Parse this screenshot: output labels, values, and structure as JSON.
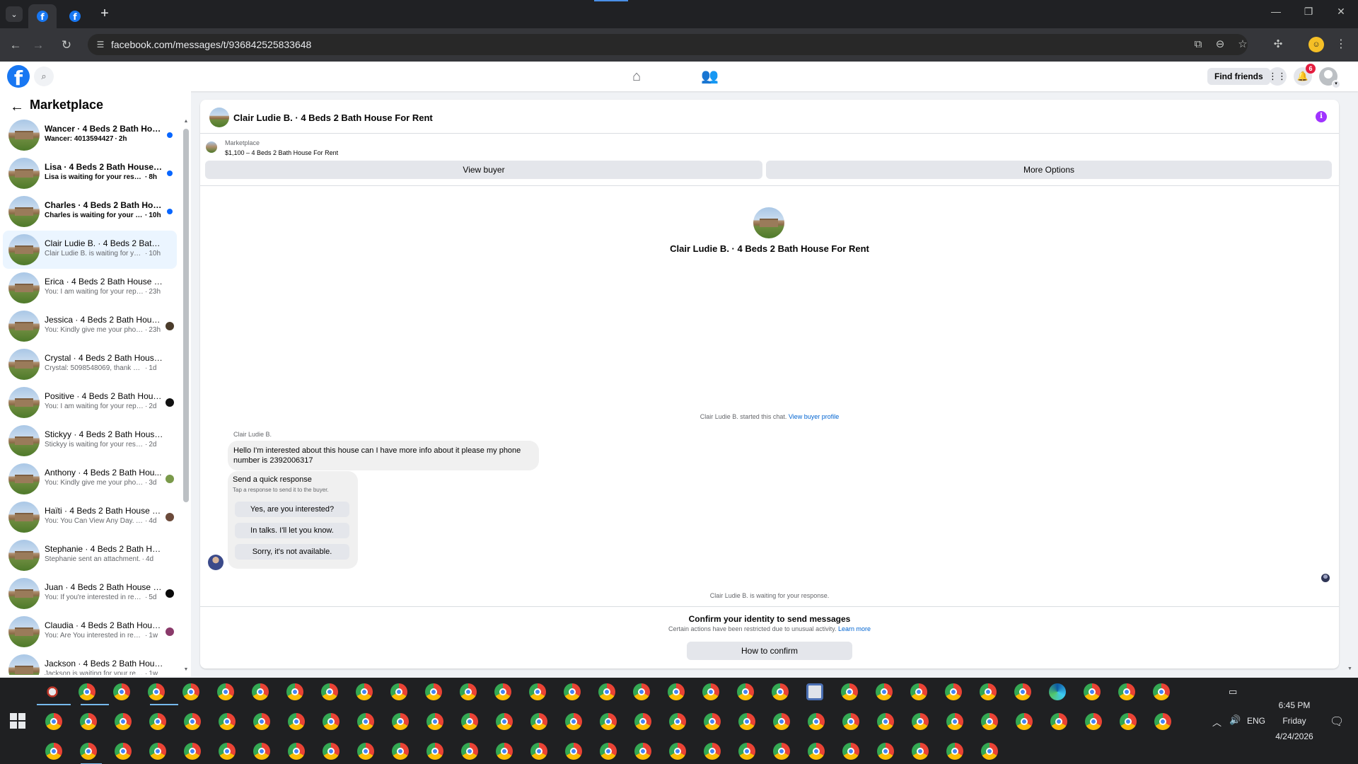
{
  "browser": {
    "url": "facebook.com/messages/t/936842525833648",
    "new_tab_label": "+"
  },
  "fb_header": {
    "find_friends_label": "Find friends",
    "notification_count": "6"
  },
  "sidebar": {
    "title": "Marketplace",
    "conversations": [
      {
        "name": "Wancer · 4 Beds 2 Bath House...",
        "preview": "Wancer: 4013594427",
        "time": "2h",
        "unread": true,
        "indicator": "unread"
      },
      {
        "name": "Lisa · 4 Beds 2 Bath House Fo...",
        "preview": "Lisa is waiting for your response.",
        "time": "8h",
        "unread": true,
        "indicator": "unread"
      },
      {
        "name": "Charles · 4 Beds 2 Bath House...",
        "preview": "Charles is waiting for your res...",
        "time": "10h",
        "unread": true,
        "indicator": "unread"
      },
      {
        "name": "Clair Ludie B. · 4 Beds 2 Bath H...",
        "preview": "Clair Ludie B. is waiting for your r...",
        "time": "10h",
        "unread": false,
        "indicator": "none",
        "selected": true
      },
      {
        "name": "Erica · 4 Beds 2 Bath House For ...",
        "preview": "You: I am waiting for your reply, ...",
        "time": "23h",
        "unread": false,
        "indicator": "none"
      },
      {
        "name": "Jessica · 4 Beds 2 Bath House...",
        "preview": "You: Kindly give me your phon...",
        "time": "23h",
        "unread": false,
        "indicator": "seen",
        "seen_color": "#4a3b2a"
      },
      {
        "name": "Crystal · 4 Beds 2 Bath House F...",
        "preview": "Crystal: 5098548069, thank you",
        "time": "1d",
        "unread": false,
        "indicator": "none"
      },
      {
        "name": "Positive · 4 Beds 2 Bath Hous...",
        "preview": "You: I am waiting for your reply,...",
        "time": "2d",
        "unread": false,
        "indicator": "seen",
        "seen_color": "#111111"
      },
      {
        "name": "Stickyy · 4 Beds 2 Bath House F...",
        "preview": "Stickyy is waiting for your response.",
        "time": "2d",
        "unread": false,
        "indicator": "none"
      },
      {
        "name": "Anthony · 4 Beds 2 Bath Hou...",
        "preview": "You: Kindly give me your phone...",
        "time": "3d",
        "unread": false,
        "indicator": "seen",
        "seen_color": "#7a9a4a"
      },
      {
        "name": "Haïti · 4 Beds 2 Bath House F...",
        "preview": "You: You Can View Any Day. All ...",
        "time": "4d",
        "unread": false,
        "indicator": "seen",
        "seen_color": "#6b4a3a"
      },
      {
        "name": "Stephanie · 4 Beds 2 Bath Hous...",
        "preview": "Stephanie sent an attachment.",
        "time": "4d",
        "unread": false,
        "indicator": "none"
      },
      {
        "name": "Juan · 4 Beds 2 Bath House F...",
        "preview": "You: If you're interested in renti...",
        "time": "5d",
        "unread": false,
        "indicator": "seen",
        "seen_color": "#0a0a0a"
      },
      {
        "name": "Claudia · 4 Beds 2 Bath Hous...",
        "preview": "You: Are You interested in renti...",
        "time": "1w",
        "unread": false,
        "indicator": "seen",
        "seen_color": "#8a3a6a"
      },
      {
        "name": "Jackson · 4 Beds 2 Bath House ...",
        "preview": "Jackson is waiting for your respon...",
        "time": "1w",
        "unread": false,
        "indicator": "none"
      }
    ]
  },
  "chat": {
    "header_title": "Clair Ludie B. · 4 Beds 2 Bath House For Rent",
    "listing_label": "Marketplace",
    "listing_price_title": "$1,100 – 4 Beds 2 Bath House For Rent",
    "view_buyer_label": "View buyer",
    "more_options_label": "More Options",
    "center_name": "Clair Ludie B. · 4 Beds 2 Bath House For Rent",
    "started_text": "Clair Ludie B. started this chat.",
    "view_buyer_profile_label": "View buyer profile",
    "sender_name": "Clair Ludie B.",
    "message_text": "Hello I'm interested about this house can I have more info about it please my phone number is 2392006317",
    "quick_response_title": "Send a quick response",
    "quick_response_subtitle": "Tap a response to send it to the buyer.",
    "quick_responses": [
      "Yes, are you interested?",
      "In talks. I'll let you know.",
      "Sorry, it's not available."
    ],
    "waiting_text": "Clair Ludie B. is waiting for your response.",
    "confirm_title": "Confirm your identity to send messages",
    "confirm_subtitle": "Certain actions have been restricted due to unusual activity.",
    "learn_more_label": "Learn more",
    "confirm_button_label": "How to confirm"
  },
  "taskbar": {
    "time": "6:45 PM",
    "day": "Friday",
    "date": "4/24/2026",
    "language": "ENG"
  },
  "colors": {
    "fb_blue": "#1877f2",
    "unread_dot": "#0866ff",
    "link": "#0064d1",
    "info_purple": "#a033ff",
    "badge_red": "#e41e3f"
  }
}
